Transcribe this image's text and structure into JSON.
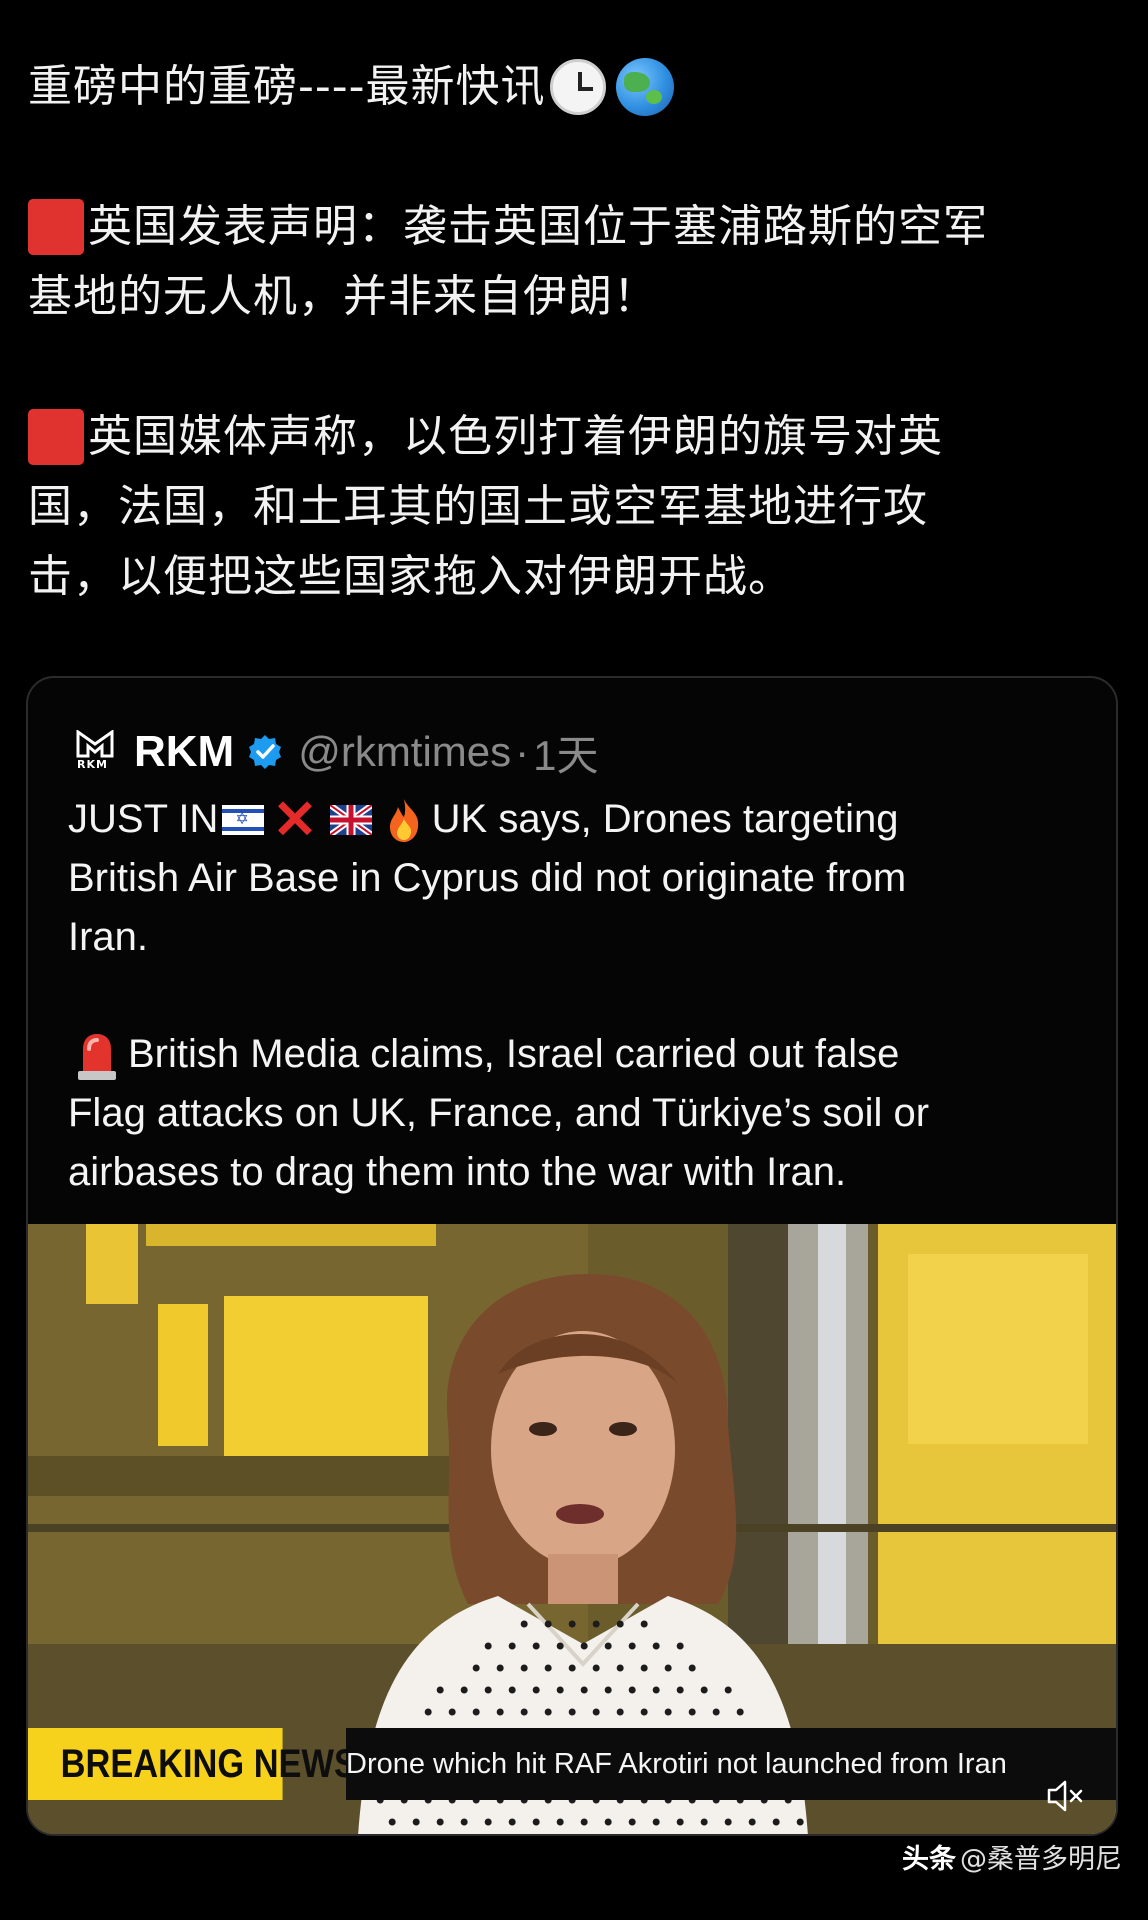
{
  "post": {
    "line1": "重磅中的重磅----最新快讯",
    "para1_line1": "英国发表声明：袭击英国位于塞浦路斯的空军",
    "para1_line2": "基地的无人机，并非来自伊朗！",
    "para2_line1": "英国媒体声称，以色列打着伊朗的旗号对英",
    "para2_line2": "国，法国，和土耳其的国土或空军基地进行攻",
    "para2_line3": "击，以便把这些国家拖入对伊朗开战。"
  },
  "tweet": {
    "author": "RKM",
    "logo_text": "RKM",
    "handle": "@rkmtimes",
    "separator": "·",
    "time": "1天",
    "line1_prefix": "JUST IN",
    "line1_suffix": "UK says, Drones targeting",
    "line2": "British Air Base in Cyprus did not originate from",
    "line3": "Iran.",
    "line4": "British Media claims, Israel carried out false",
    "line5": "Flag attacks on UK, France, and Türkiye’s soil or",
    "line6": "airbases to drag them into the war with Iran."
  },
  "video": {
    "breaking_label": "BREAKING NEWS",
    "ticker": "Drone which hit RAF Akrotiri not launched from Iran"
  },
  "watermark": {
    "brand": "头条",
    "handle": "@桑普多明尼"
  },
  "colors": {
    "background": "#000000",
    "red_square": "#e0332f",
    "verified_blue": "#1d9bf0",
    "breaking_yellow": "#f7d21d"
  },
  "icons": [
    "clock-icon",
    "globe-icon",
    "red-square-icon",
    "rkm-logo",
    "verified-badge-icon",
    "israel-flag-icon",
    "cross-mark-icon",
    "uk-flag-icon",
    "fire-icon",
    "siren-icon",
    "mute-icon"
  ]
}
